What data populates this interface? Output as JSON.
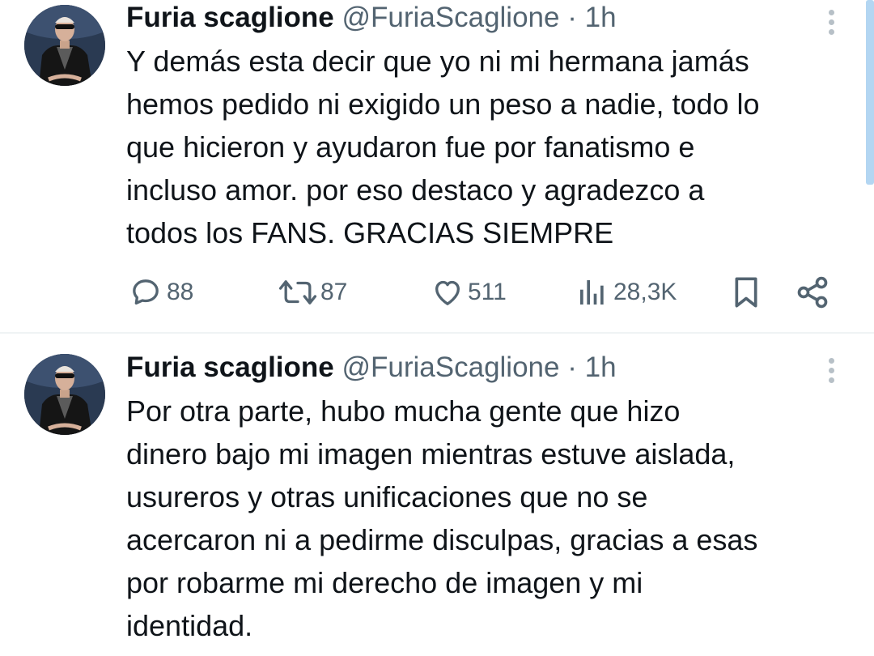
{
  "tweets": [
    {
      "author_name": "Furia scaglione",
      "handle": "@FuriaScaglione",
      "separator": "·",
      "time": "1h",
      "lines": [
        "Y demás esta decir que yo ni mi hermana jamás",
        "hemos pedido ni exigido un peso a nadie, todo lo",
        "que hicieron y ayudaron fue por fanatismo e",
        "incluso amor. por eso destaco y agradezco a",
        "todos los FANS. GRACIAS SIEMPRE"
      ],
      "actions": {
        "replies": "88",
        "retweets": "87",
        "likes": "511",
        "views": "28,3K"
      }
    },
    {
      "author_name": "Furia scaglione",
      "handle": "@FuriaScaglione",
      "separator": "·",
      "time": "1h",
      "lines": [
        "Por otra parte, hubo mucha gente que hizo",
        "dinero bajo mi imagen mientras estuve aislada,",
        "usureros y otras unificaciones que no se",
        "acercaron ni a pedirme disculpas, gracias a esas",
        "por robarme mi derecho de imagen y mi",
        "identidad."
      ]
    }
  ],
  "icons": {
    "reply": "comment-bubble-icon",
    "retweet": "retweet-arrows-icon",
    "like": "heart-icon",
    "views": "bar-chart-icon",
    "bookmark": "bookmark-icon",
    "share": "share-icon",
    "more": "vertical-dots-icon"
  },
  "colors": {
    "text_primary": "#0f1419",
    "text_secondary": "#536471",
    "divider": "#eff3f4",
    "scroll_accent": "#b3d6f2"
  }
}
